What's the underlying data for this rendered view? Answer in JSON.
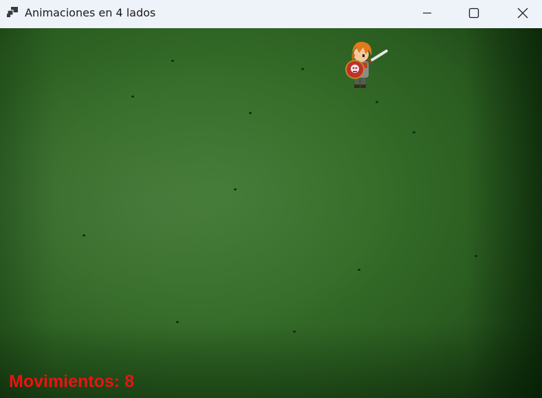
{
  "window": {
    "title": "Animaciones en 4 lados",
    "icon": "app-window-icon",
    "controls": {
      "minimize": "minimize-icon",
      "maximize": "maximize-icon",
      "close": "close-icon"
    }
  },
  "game": {
    "background": "green-grunge-field",
    "player_sprite": "knight-with-sword-and-shield",
    "hud": {
      "moves_text": "Movimientos: 8",
      "color": "#ee1212"
    }
  },
  "colors": {
    "titlebar": "#eef2f9",
    "field": "#356d29"
  }
}
